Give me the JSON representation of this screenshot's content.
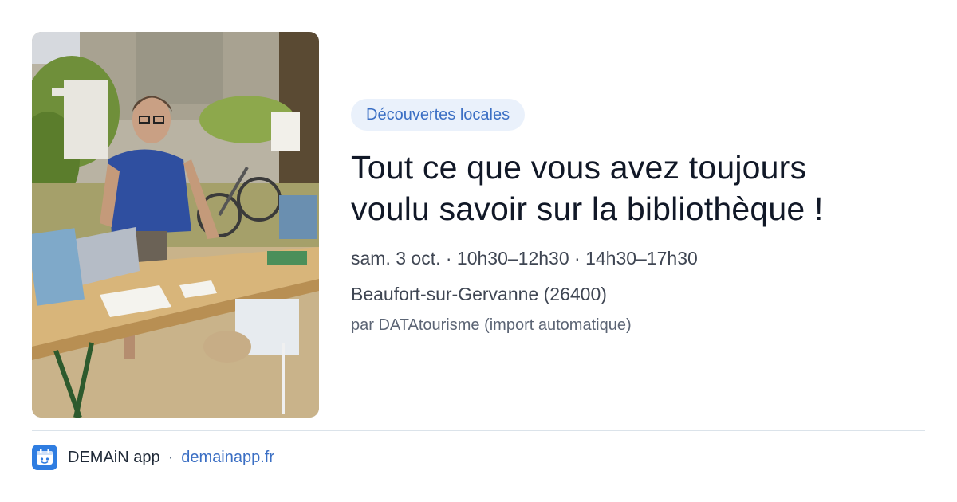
{
  "event": {
    "category": "Découvertes locales",
    "title": "Tout ce que vous avez toujours voulu savoir sur la bibliothèque !",
    "schedule": "sam. 3 oct. · 10h30–12h30 · 14h30–17h30",
    "location": "Beaufort-sur-Gervanne (26400)",
    "source": "par DATAtourisme (import automatique)",
    "photo_icon": "event-photo"
  },
  "footer": {
    "app_name": "DEMAiN app",
    "separator": "·",
    "domain": "demainapp.fr",
    "icon": "demain-app-logo-icon"
  },
  "colors": {
    "accent": "#3b6fc4",
    "chip_bg": "#eaf1fb",
    "text_primary": "#111827",
    "text_secondary": "#3f4653",
    "divider": "#dbe3ea"
  }
}
